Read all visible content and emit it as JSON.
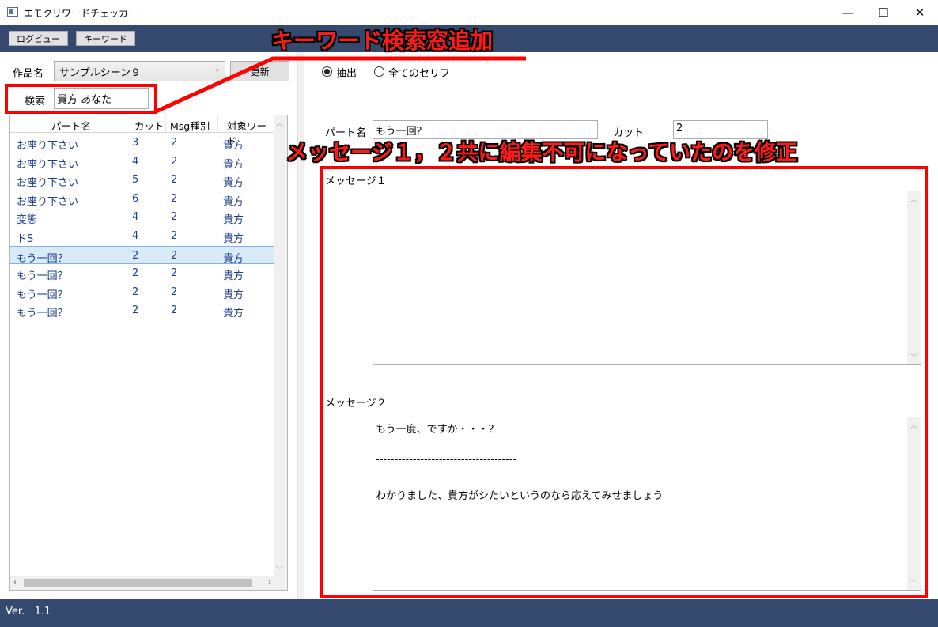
{
  "window": {
    "title": "エモクリワードチェッカー",
    "minimize_glyph": "—",
    "maximize_glyph": "☐",
    "close_glyph": "✕"
  },
  "toolbar": {
    "log_view_label": "ログビュー",
    "keyword_label": "キーワード"
  },
  "left": {
    "work_label": "作品名",
    "work_selected": "サンプルシーン９",
    "update_label": "更新",
    "search_label": "検索",
    "search_value": "貴方 あなた"
  },
  "grid": {
    "columns": [
      "パート名",
      "カット",
      "Msg種別",
      "対象ワード"
    ],
    "rows": [
      {
        "part": "お座り下さい",
        "cut": "3",
        "msg": "2",
        "word": "貴方"
      },
      {
        "part": "お座り下さい",
        "cut": "4",
        "msg": "2",
        "word": "貴方"
      },
      {
        "part": "お座り下さい",
        "cut": "5",
        "msg": "2",
        "word": "貴方"
      },
      {
        "part": "お座り下さい",
        "cut": "6",
        "msg": "2",
        "word": "貴方"
      },
      {
        "part": "変態",
        "cut": "4",
        "msg": "2",
        "word": "貴方"
      },
      {
        "part": "ドS",
        "cut": "4",
        "msg": "2",
        "word": "貴方"
      },
      {
        "part": "もう一回？",
        "cut": "2",
        "msg": "2",
        "word": "貴方"
      },
      {
        "part": "もう一回？",
        "cut": "2",
        "msg": "2",
        "word": "貴方"
      },
      {
        "part": "もう一回？",
        "cut": "2",
        "msg": "2",
        "word": "貴方"
      },
      {
        "part": "もう一回？",
        "cut": "2",
        "msg": "2",
        "word": "貴方"
      }
    ],
    "selected_row": 6
  },
  "right": {
    "radio_extract": "抽出",
    "radio_all": "全てのセリフ",
    "part_label": "パート名",
    "part_value": "もう一回？",
    "cut_label": "カット",
    "cut_value": "2",
    "message1_label": "メッセージ１",
    "message2_label": "メッセージ２",
    "message1_lines": [],
    "message2_lines": [
      "もう一度、ですか・・・？",
      "",
      "--------------------------------------",
      "",
      "わかりました、貴方がシたいというのなら応えてみせましょう"
    ]
  },
  "status": {
    "version": "Ver.   1.1"
  },
  "annotations": {
    "keyword_note": "キーワード検索窓追加",
    "message_note": "メッセージ１，２共に編集不可になっていたのを修正",
    "color": "#ff1a1a"
  }
}
